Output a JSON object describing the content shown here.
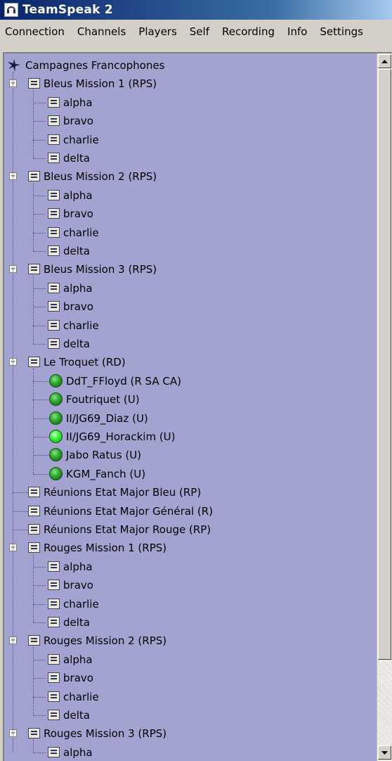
{
  "window": {
    "title": "TeamSpeak 2",
    "icon": "headset-icon"
  },
  "menu": [
    "Connection",
    "Channels",
    "Players",
    "Self",
    "Recording",
    "Info",
    "Settings"
  ],
  "server": {
    "name": "Campagnes Francophones",
    "icon": "plane-icon"
  },
  "tree": [
    {
      "type": "channel",
      "label": "Bleus Mission 1   (RPS)",
      "expanded": true,
      "children": [
        {
          "type": "channel",
          "label": "alpha"
        },
        {
          "type": "channel",
          "label": "bravo"
        },
        {
          "type": "channel",
          "label": "charlie"
        },
        {
          "type": "channel",
          "label": "delta"
        }
      ]
    },
    {
      "type": "channel",
      "label": "Bleus Mission 2   (RPS)",
      "expanded": true,
      "children": [
        {
          "type": "channel",
          "label": "alpha"
        },
        {
          "type": "channel",
          "label": "bravo"
        },
        {
          "type": "channel",
          "label": "charlie"
        },
        {
          "type": "channel",
          "label": "delta"
        }
      ]
    },
    {
      "type": "channel",
      "label": "Bleus Mission 3   (RPS)",
      "expanded": true,
      "children": [
        {
          "type": "channel",
          "label": "alpha"
        },
        {
          "type": "channel",
          "label": "bravo"
        },
        {
          "type": "channel",
          "label": "charlie"
        },
        {
          "type": "channel",
          "label": "delta"
        }
      ]
    },
    {
      "type": "channel",
      "label": "Le Troquet   (RD)",
      "expanded": true,
      "children": [
        {
          "type": "player",
          "label": "DdT_FFloyd  (R SA CA)"
        },
        {
          "type": "player",
          "label": "Foutriquet  (U)"
        },
        {
          "type": "player",
          "label": "II/JG69_Diaz  (U)"
        },
        {
          "type": "player",
          "label": "II/JG69_Horackim  (U)",
          "talking": true
        },
        {
          "type": "player",
          "label": "Jabo Ratus  (U)"
        },
        {
          "type": "player",
          "label": "KGM_Fanch  (U)"
        }
      ]
    },
    {
      "type": "channel",
      "label": "Réunions Etat Major Bleu   (RP)"
    },
    {
      "type": "channel",
      "label": "Réunions Etat Major Général   (R)"
    },
    {
      "type": "channel",
      "label": "Réunions Etat Major Rouge   (RP)"
    },
    {
      "type": "channel",
      "label": "Rouges Mission 1   (RPS)",
      "expanded": true,
      "children": [
        {
          "type": "channel",
          "label": "alpha"
        },
        {
          "type": "channel",
          "label": "bravo"
        },
        {
          "type": "channel",
          "label": "charlie"
        },
        {
          "type": "channel",
          "label": "delta"
        }
      ]
    },
    {
      "type": "channel",
      "label": "Rouges Mission 2   (RPS)",
      "expanded": true,
      "children": [
        {
          "type": "channel",
          "label": "alpha"
        },
        {
          "type": "channel",
          "label": "bravo"
        },
        {
          "type": "channel",
          "label": "charlie"
        },
        {
          "type": "channel",
          "label": "delta"
        }
      ]
    },
    {
      "type": "channel",
      "label": "Rouges Mission 3   (RPS)",
      "expanded": true,
      "children": [
        {
          "type": "channel",
          "label": "alpha"
        }
      ]
    }
  ],
  "colors": {
    "tree_background": "#a3a3d1",
    "title_gradient_start": "#0a246a",
    "player_idle": "#2aa52a",
    "player_talking": "#33ee33"
  }
}
